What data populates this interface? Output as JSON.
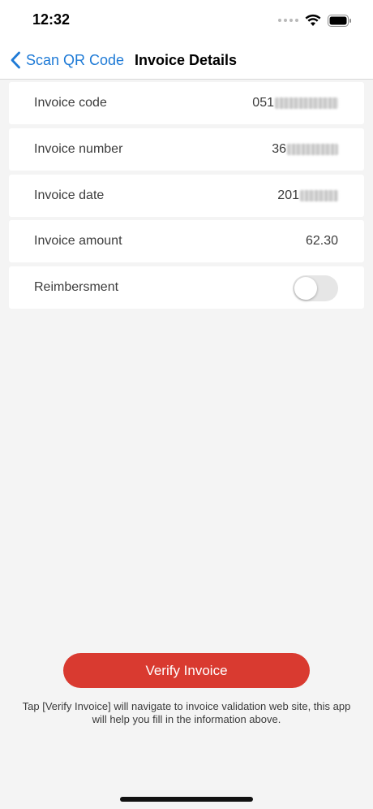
{
  "status_bar": {
    "time": "12:32",
    "icons": [
      "signal-dots-icon",
      "wifi-icon",
      "battery-icon"
    ]
  },
  "nav": {
    "back_label": "Scan QR Code",
    "title": "Invoice Details",
    "accent_color": "#1e7ad6"
  },
  "rows": [
    {
      "label": "Invoice code",
      "value": "051"
    },
    {
      "label": "Invoice number",
      "value": "36"
    },
    {
      "label": "Invoice date",
      "value": "201"
    },
    {
      "label": "Invoice amount",
      "value": "62.30"
    },
    {
      "label": "Reimbersment",
      "toggle": false
    }
  ],
  "verify": {
    "label": "Verify Invoice",
    "color": "#d93a30"
  },
  "hint": "Tap [Verify Invoice] will navigate to invoice validation web site, this app will help you fill in the information above."
}
